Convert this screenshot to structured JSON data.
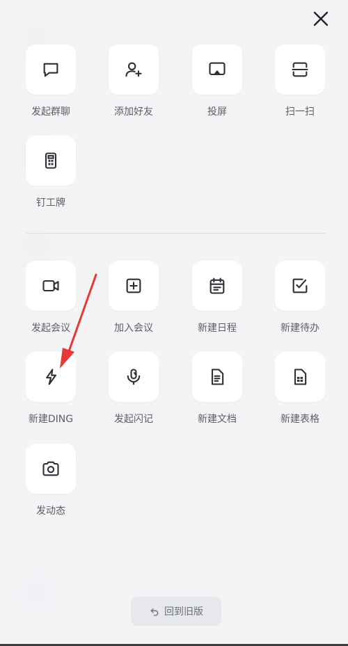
{
  "colors": {
    "tile_bg": "#ffffff",
    "icon_stroke": "#2b2f36",
    "label": "#5a5f66",
    "annotation_arrow": "#e53935"
  },
  "close": {
    "icon": "close-icon"
  },
  "section_top": [
    {
      "label": "发起群聊",
      "icon": "chat-bubble-icon"
    },
    {
      "label": "添加好友",
      "icon": "add-user-icon"
    },
    {
      "label": "投屏",
      "icon": "screen-cast-icon"
    },
    {
      "label": "扫一扫",
      "icon": "scan-icon"
    },
    {
      "label": "钉工牌",
      "icon": "badge-card-icon"
    }
  ],
  "section_bottom": [
    {
      "label": "发起会议",
      "icon": "video-camera-icon"
    },
    {
      "label": "加入会议",
      "icon": "plus-square-icon"
    },
    {
      "label": "新建日程",
      "icon": "calendar-icon"
    },
    {
      "label": "新建待办",
      "icon": "checkbox-icon"
    },
    {
      "label": "新建DING",
      "icon": "lightning-icon"
    },
    {
      "label": "发起闪记",
      "icon": "microphone-icon"
    },
    {
      "label": "新建文档",
      "icon": "document-icon"
    },
    {
      "label": "新建表格",
      "icon": "spreadsheet-icon"
    },
    {
      "label": "发动态",
      "icon": "camera-icon"
    }
  ],
  "back_button": {
    "icon": "undo-icon",
    "label": "回到旧版"
  }
}
